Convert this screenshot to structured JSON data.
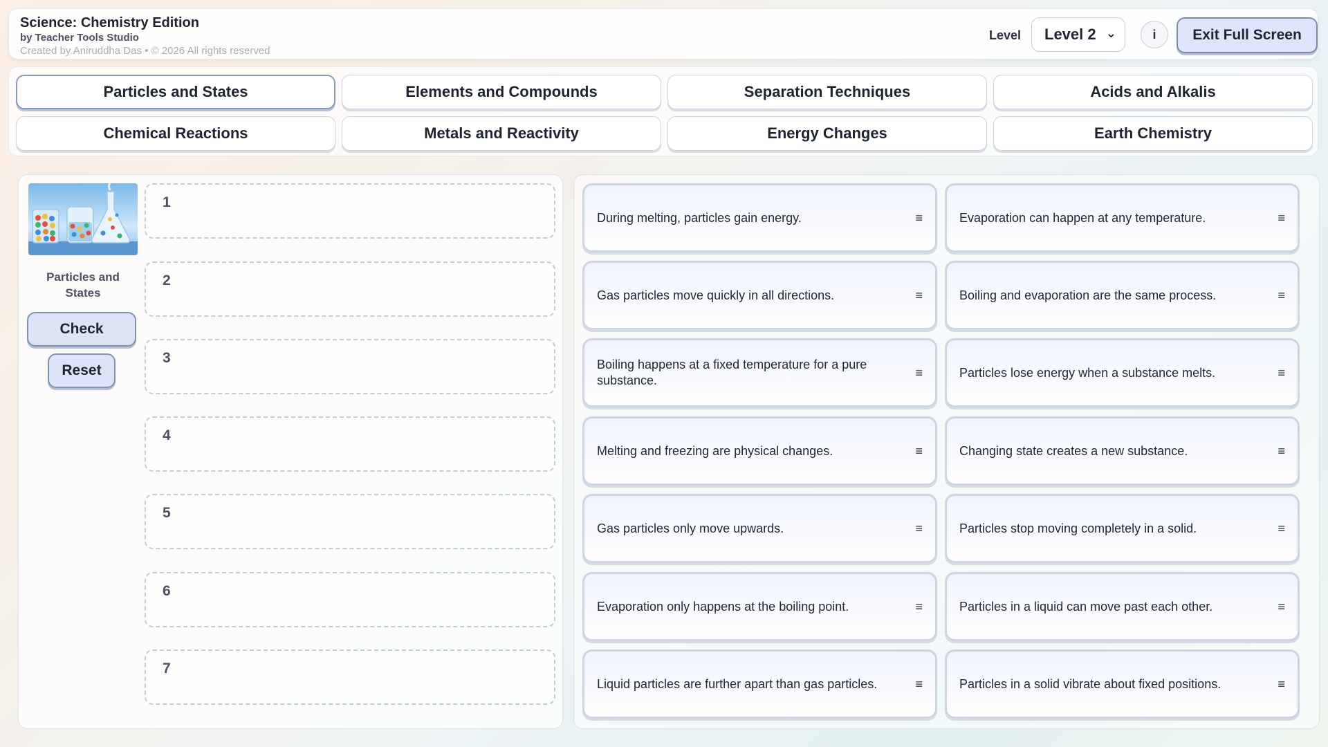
{
  "header": {
    "title": "Science: Chemistry Edition",
    "subtitle": "by Teacher Tools Studio",
    "credit": "Created by Aniruddha Das • © 2026 All rights reserved",
    "level_label": "Level",
    "level_value": "Level 2",
    "info_label": "i",
    "exit_label": "Exit Full Screen"
  },
  "tabs": [
    {
      "label": "Particles and States",
      "active": true
    },
    {
      "label": "Elements and Compounds"
    },
    {
      "label": "Separation Techniques"
    },
    {
      "label": "Acids and Alkalis"
    },
    {
      "label": "Chemical Reactions"
    },
    {
      "label": "Metals and Reactivity"
    },
    {
      "label": "Energy Changes"
    },
    {
      "label": "Earth Chemistry"
    }
  ],
  "sidebar": {
    "topic_name": "Particles and States",
    "check_label": "Check",
    "reset_label": "Reset"
  },
  "slots": [
    "1",
    "2",
    "3",
    "4",
    "5",
    "6",
    "7"
  ],
  "cards": [
    "During melting, particles gain energy.",
    "Evaporation can happen at any temperature.",
    "Gas particles move quickly in all directions.",
    "Boiling and evaporation are the same process.",
    "Boiling happens at a fixed temperature for a pure substance.",
    "Particles lose energy when a substance melts.",
    "Melting and freezing are physical changes.",
    "Changing state creates a new substance.",
    "Gas particles only move upwards.",
    "Particles stop moving completely in a solid.",
    "Evaporation only happens at the boiling point.",
    "Particles in a liquid can move past each other.",
    "Liquid particles are further apart than gas particles.",
    "Particles in a solid vibrate about fixed positions."
  ],
  "handle_icon": "drag-handle-icon"
}
